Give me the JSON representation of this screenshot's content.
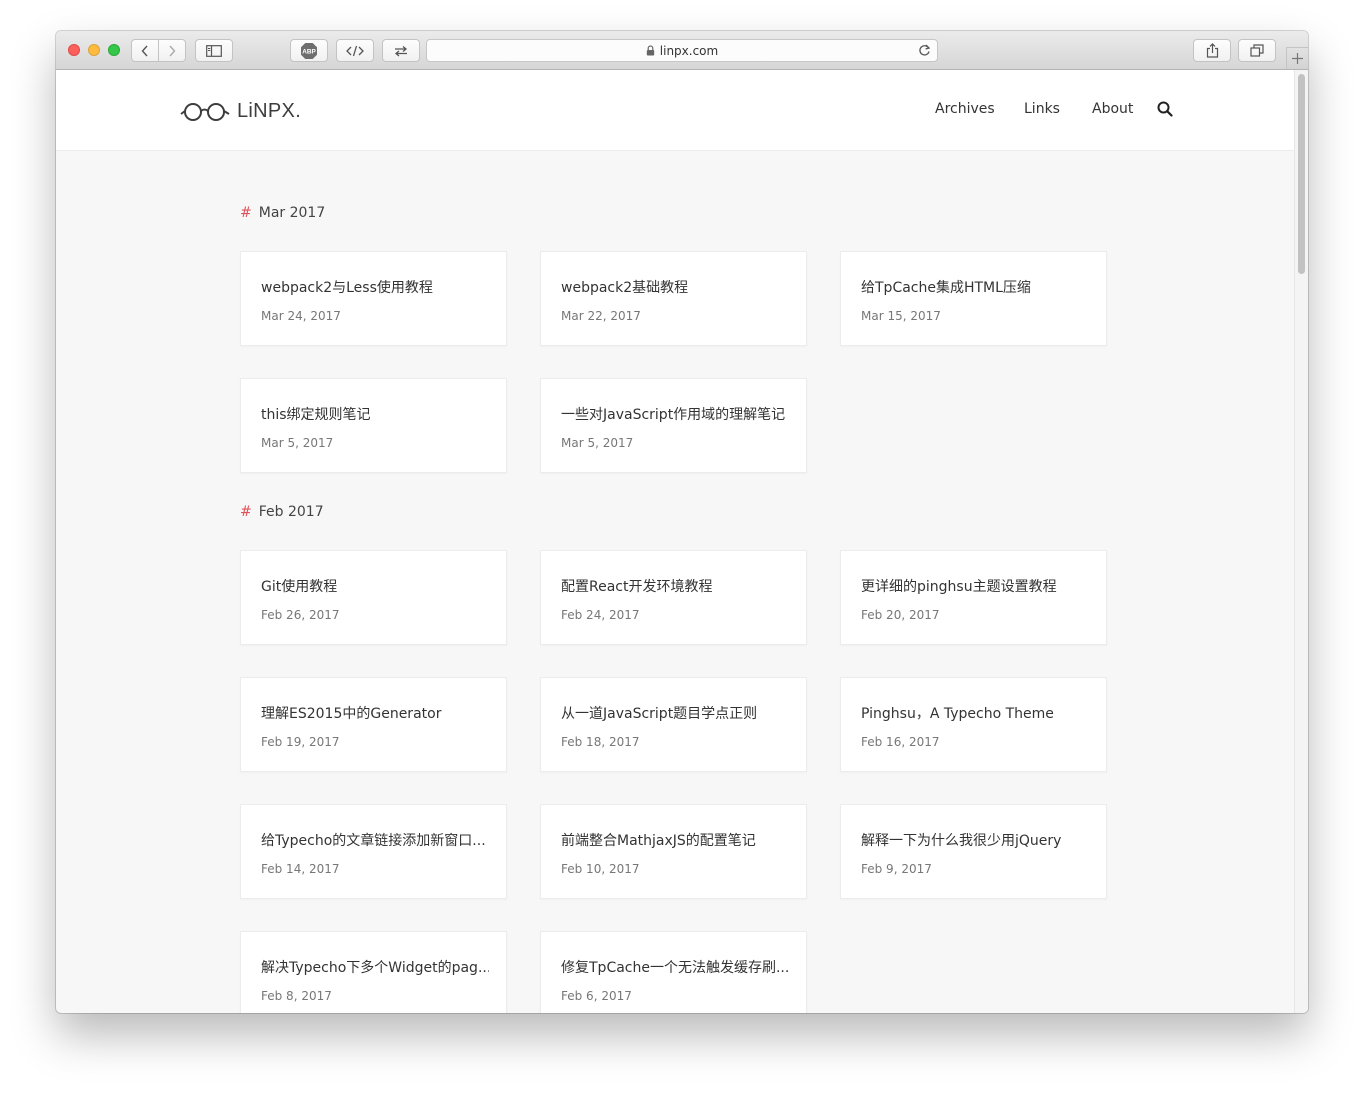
{
  "browser": {
    "url": "linpx.com",
    "abp_label": "ABP"
  },
  "site": {
    "logo_text": "LiNPX.",
    "nav": [
      {
        "label": "Archives"
      },
      {
        "label": "Links"
      },
      {
        "label": "About"
      }
    ]
  },
  "archive": {
    "months": [
      {
        "heading": "Mar 2017",
        "posts": [
          {
            "title": "webpack2与Less使用教程",
            "date": "Mar 24, 2017"
          },
          {
            "title": "webpack2基础教程",
            "date": "Mar 22, 2017"
          },
          {
            "title": "给TpCache集成HTML压缩",
            "date": "Mar 15, 2017"
          },
          {
            "title": "this绑定规则笔记",
            "date": "Mar 5, 2017"
          },
          {
            "title": "一些对JavaScript作用域的理解笔记",
            "date": "Mar 5, 2017"
          }
        ]
      },
      {
        "heading": "Feb 2017",
        "posts": [
          {
            "title": "Git使用教程",
            "date": "Feb 26, 2017"
          },
          {
            "title": "配置React开发环境教程",
            "date": "Feb 24, 2017"
          },
          {
            "title": "更详细的pinghsu主题设置教程",
            "date": "Feb 20, 2017"
          },
          {
            "title": "理解ES2015中的Generator",
            "date": "Feb 19, 2017"
          },
          {
            "title": "从一道JavaScript题目学点正则",
            "date": "Feb 18, 2017"
          },
          {
            "title": "Pinghsu，A Typecho Theme",
            "date": "Feb 16, 2017"
          },
          {
            "title": "给Typecho的文章链接添加新窗口...",
            "date": "Feb 14, 2017"
          },
          {
            "title": "前端整合MathjaxJS的配置笔记",
            "date": "Feb 10, 2017"
          },
          {
            "title": "解释一下为什么我很少用jQuery",
            "date": "Feb 9, 2017"
          },
          {
            "title": "解决Typecho下多个Widget的pag...",
            "date": "Feb 8, 2017"
          },
          {
            "title": "修复TpCache一个无法触发缓存刷...",
            "date": "Feb 6, 2017"
          }
        ]
      }
    ]
  }
}
